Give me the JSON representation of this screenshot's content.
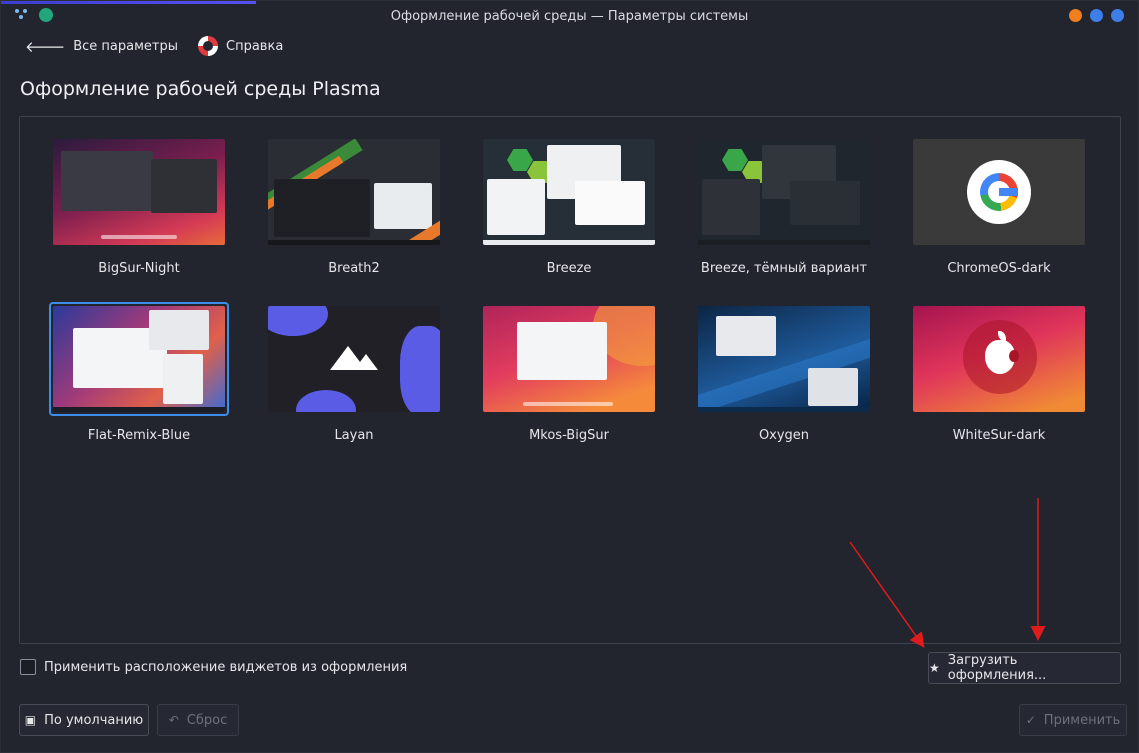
{
  "window": {
    "title": "Оформление рабочей среды — Параметры системы"
  },
  "toolbar": {
    "back_label": "Все параметры",
    "help_label": "Справка"
  },
  "page": {
    "title": "Оформление рабочей среды Plasma"
  },
  "themes": [
    {
      "label": "BigSur-Night",
      "selected": false
    },
    {
      "label": "Breath2",
      "selected": false
    },
    {
      "label": "Breeze",
      "selected": false
    },
    {
      "label": "Breeze, тёмный вариант",
      "selected": false
    },
    {
      "label": "ChromeOS-dark",
      "selected": false
    },
    {
      "label": "Flat-Remix-Blue",
      "selected": true
    },
    {
      "label": "Layan",
      "selected": false
    },
    {
      "label": "Mkos-BigSur",
      "selected": false
    },
    {
      "label": "Oxygen",
      "selected": false
    },
    {
      "label": "WhiteSur-dark",
      "selected": false
    }
  ],
  "options": {
    "apply_layout_label": "Применить расположение виджетов из оформления",
    "apply_layout_checked": false
  },
  "buttons": {
    "get_new_label": "Загрузить оформления...",
    "defaults_label": "По умолчанию",
    "reset_label": "Сброс",
    "apply_label": "Применить"
  },
  "colors": {
    "accent": "#3d8ee8",
    "window_bg": "#22242e",
    "close_btn": "#f07f1e",
    "max_btn": "#3d7ee8",
    "min_btn": "#3d7ee8",
    "annotation": "#e01b1b"
  },
  "icons": {
    "back": "arrow-left-icon",
    "help": "lifebuoy-icon",
    "get_new": "star-icon",
    "defaults": "document-revert-icon",
    "reset": "undo-icon",
    "apply": "checkmark-icon"
  }
}
